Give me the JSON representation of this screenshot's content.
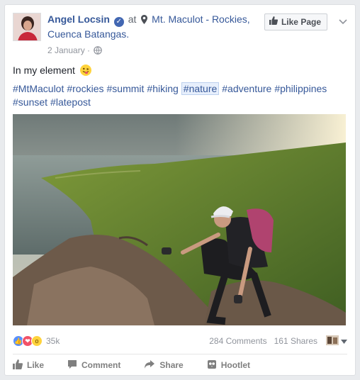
{
  "post": {
    "author": "Angel Locsin",
    "at_text": "at",
    "location": "Mt. Maculot - Rockies, Cuenca Batangas.",
    "date": "2 January",
    "dot": "·",
    "like_page_label": "Like Page",
    "caption": "In my element",
    "hashtags": [
      "#MtMaculot",
      "#rockies",
      "#summit",
      "#hiking",
      "#nature",
      "#adventure",
      "#philippines",
      "#sunset",
      "#latepost"
    ]
  },
  "stats": {
    "reactions_count": "35k",
    "comments": "284 Comments",
    "shares": "161 Shares"
  },
  "actions": {
    "like": "Like",
    "comment": "Comment",
    "share": "Share",
    "hootlet": "Hootlet"
  },
  "colors": {
    "link": "#365899",
    "muted": "#90949c",
    "verified": "#4267b2",
    "like_reaction": "#5890ff",
    "love_reaction": "#f25268",
    "wow_reaction": "#ffd33c"
  },
  "icons": {
    "verified": "verified-badge-icon",
    "location": "map-pin-icon",
    "privacy": "globe-icon",
    "like_page": "thumbs-up-icon",
    "options": "chevron-down-icon"
  }
}
